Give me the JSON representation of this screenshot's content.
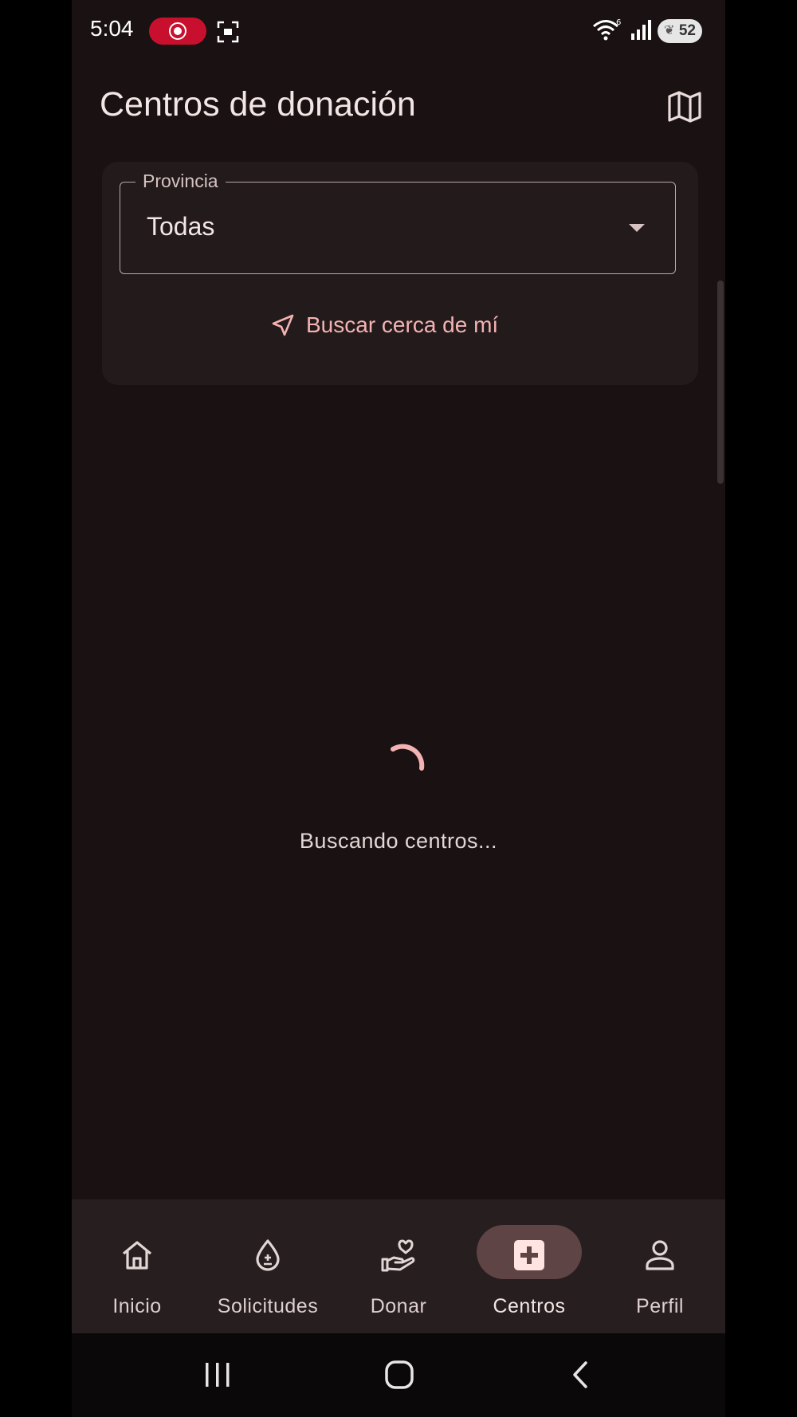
{
  "status_bar": {
    "time": "5:04",
    "battery": "52"
  },
  "header": {
    "title": "Centros de donación"
  },
  "filter": {
    "label": "Provincia",
    "value": "Todas",
    "near_me_label": "Buscar cerca de mí"
  },
  "loading": {
    "text": "Buscando centros..."
  },
  "bottom_nav": {
    "items": [
      {
        "label": "Inicio",
        "icon": "home-icon"
      },
      {
        "label": "Solicitudes",
        "icon": "blood-drop-icon"
      },
      {
        "label": "Donar",
        "icon": "donate-hand-icon"
      },
      {
        "label": "Centros",
        "icon": "medical-cross-icon",
        "active": true
      },
      {
        "label": "Perfil",
        "icon": "person-icon"
      }
    ]
  },
  "colors": {
    "background": "#1a1112",
    "card": "#231a1b",
    "accent": "#f4b3b3",
    "active_pill": "#5e4444",
    "record_pill": "#c8102e"
  }
}
